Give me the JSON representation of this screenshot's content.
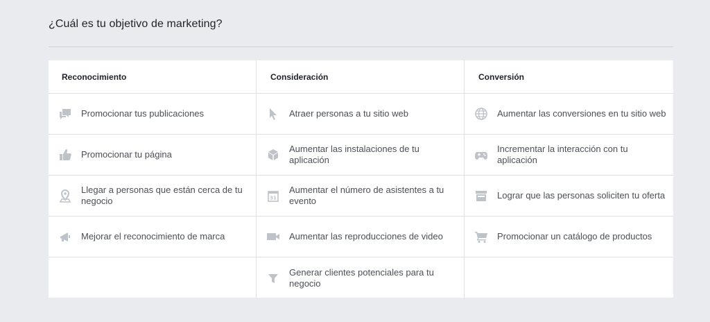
{
  "page_title": "¿Cuál es tu objetivo de marketing?",
  "colors": {
    "icon": "#bec3c9",
    "text": "#4b4f56",
    "heading": "#1d2129",
    "border": "#dddfe2"
  },
  "columns": [
    {
      "heading": "Reconocimiento",
      "items": [
        {
          "label": "Promocionar tus publicaciones",
          "icon": "chat-bubbles-icon"
        },
        {
          "label": "Promocionar tu página",
          "icon": "thumbs-up-icon"
        },
        {
          "label": "Llegar a personas que están cerca de tu negocio",
          "icon": "map-pin-icon"
        },
        {
          "label": "Mejorar el reconocimiento de marca",
          "icon": "megaphone-icon"
        }
      ]
    },
    {
      "heading": "Consideración",
      "items": [
        {
          "label": "Atraer personas a tu sitio web",
          "icon": "cursor-icon"
        },
        {
          "label": "Aumentar las instalaciones de tu aplicación",
          "icon": "cube-icon"
        },
        {
          "label": "Aumentar el número de asistentes a tu evento",
          "icon": "calendar-icon"
        },
        {
          "label": "Aumentar las reproducciones de video",
          "icon": "video-camera-icon"
        },
        {
          "label": "Generar clientes potenciales para tu negocio",
          "icon": "funnel-icon"
        }
      ]
    },
    {
      "heading": "Conversión",
      "items": [
        {
          "label": "Aumentar las conversiones en tu sitio web",
          "icon": "globe-icon"
        },
        {
          "label": "Incrementar la interacción con tu aplicación",
          "icon": "gamepad-icon"
        },
        {
          "label": "Lograr que las personas soliciten tu oferta",
          "icon": "storefront-icon"
        },
        {
          "label": "Promocionar un catálogo de productos",
          "icon": "shopping-cart-icon"
        }
      ]
    }
  ]
}
